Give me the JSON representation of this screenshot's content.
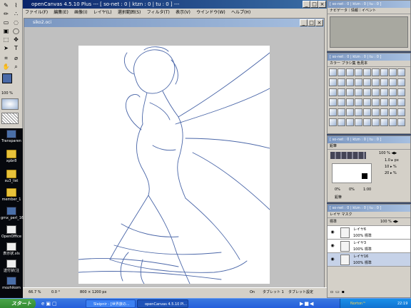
{
  "app": {
    "title": "openCanvas 4.5.10 Plus --- [ so-net : 0 | ktzn : 0 | tu : 0 ] ---",
    "menus": [
      "ファイル(F)",
      "編集(E)",
      "画像(I)",
      "レイヤ(L)",
      "選択範囲(S)",
      "フィルタ(T)",
      "表示(V)",
      "ウインドウ(W)",
      "ヘルプ(H)"
    ]
  },
  "document": {
    "title": "siko2.oci"
  },
  "toolbox": {
    "zoom": "100 %"
  },
  "status": {
    "zoom": "66.7 %",
    "angle": "0.0 °",
    "size": "800 × 1200 px",
    "pressure": "On",
    "tablet": "タブレット 1",
    "tablet_setting": "タブレット設定"
  },
  "navigator": {
    "title": "[ so-net : 0 | ktzn : 0 | tu : 0 ]",
    "tabs": "ナビゲータ｜情報｜イベント"
  },
  "color_brush": {
    "title": "[ so-net : 0 | ktzn : 0 | tu : 0 ]",
    "tabs": "カラー ブラシ集 色見本"
  },
  "pencil": {
    "title": "[ so-net : 0 | ktzn : 0 | tu : 0 ]",
    "tab": "鉛筆",
    "opacity": "100 % ◀▶",
    "size": "1.0 ▸ px",
    "density": "10 ▸ %",
    "value": "20 ▸ %",
    "scale_min": "0%",
    "scale_max": "1:00",
    "scale_mid": "0%",
    "name": "鉛筆"
  },
  "layers": {
    "title": "[ so-net : 0 | ktzn : 0 | tu : 0 ]",
    "tabs": "レイヤ マスク",
    "mode": "標準",
    "opacity": "100 % ◀▶",
    "rows": [
      {
        "name": "レイヤ6",
        "mode": "100% 標準"
      },
      {
        "name": "レイヤ3",
        "mode": "100% 標準"
      },
      {
        "name": "レイヤ16",
        "mode": "100% 標準"
      }
    ]
  },
  "desktop": {
    "icons": [
      "Transparen",
      "xpbr8",
      "su3_list",
      "member_1",
      "gmx_perl_16",
      "OpenOffice",
      "表示状.xls",
      "送付状(注",
      "mozhikom"
    ]
  },
  "taskbar": {
    "start": "スタート",
    "tasks": [
      "Sleipnir - [世界旅の...",
      "openCanvas 4.5.10 Pl..."
    ],
    "norton": "Norton™",
    "clock": "22:19"
  }
}
